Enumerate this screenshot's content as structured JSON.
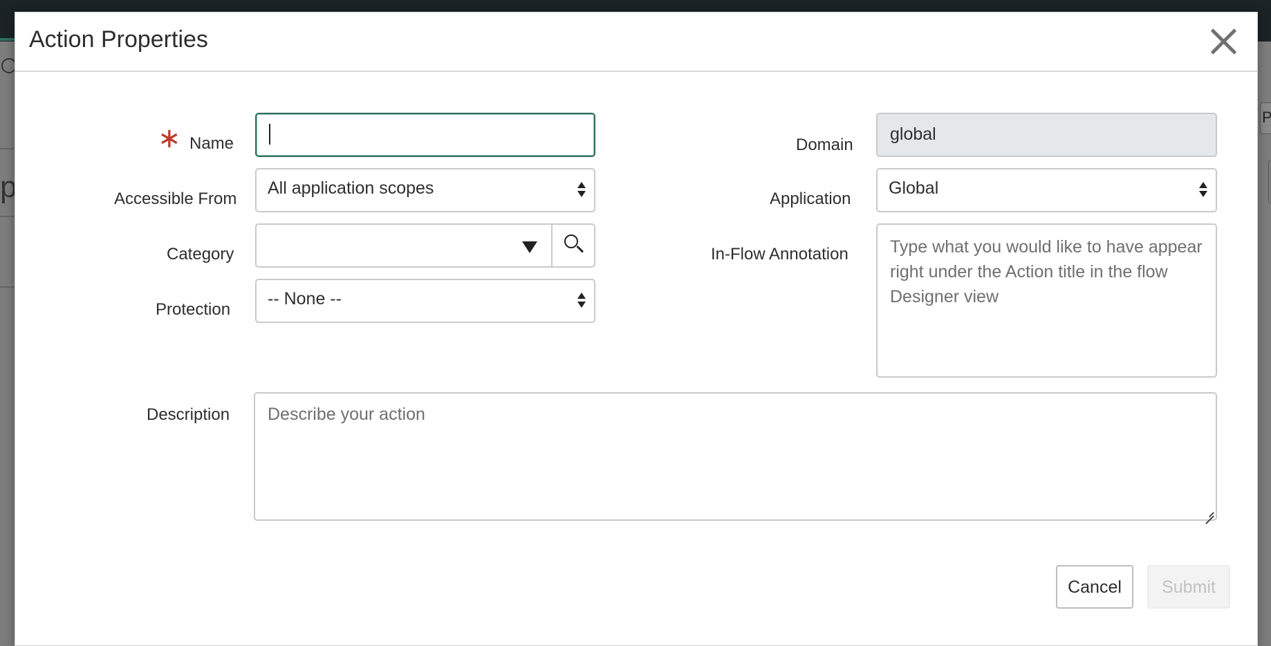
{
  "modal": {
    "title": "Action Properties"
  },
  "form": {
    "name": {
      "label": "Name",
      "value": "",
      "required": true
    },
    "accessible_from": {
      "label": "Accessible From",
      "value": "All application scopes"
    },
    "category": {
      "label": "Category",
      "value": ""
    },
    "protection": {
      "label": "Protection",
      "value": "-- None --"
    },
    "domain": {
      "label": "Domain",
      "value": "global"
    },
    "application": {
      "label": "Application",
      "value": "Global"
    },
    "in_flow_annotation": {
      "label": "In-Flow Annotation",
      "placeholder": "Type what you would like to have appear right under the Action title in the flow Designer view"
    },
    "description": {
      "label": "Description",
      "placeholder": "Describe your action"
    }
  },
  "buttons": {
    "cancel": "Cancel",
    "submit": "Submit"
  },
  "background": {
    "partial_letter": "p",
    "partial_button": "P"
  },
  "colors": {
    "accent": "#2f6f5f",
    "required": "#c0392b",
    "readonly_bg": "#e5e8ea"
  }
}
